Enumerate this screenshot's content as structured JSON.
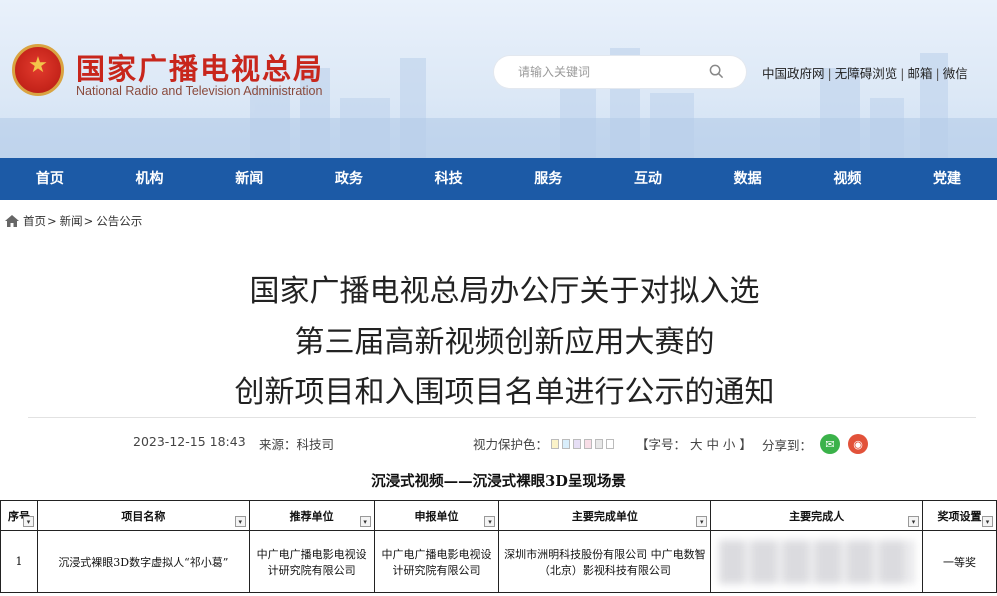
{
  "header": {
    "logo_cn": "国家广播电视总局",
    "logo_en": "National Radio and Television Administration",
    "search_placeholder": "请输入关键词",
    "top_links": [
      "中国政府网",
      "无障碍浏览",
      "邮箱",
      "微信"
    ]
  },
  "nav": [
    "首页",
    "机构",
    "新闻",
    "政务",
    "科技",
    "服务",
    "互动",
    "数据",
    "视频",
    "党建"
  ],
  "breadcrumb": [
    "首页",
    "新闻",
    "公告公示"
  ],
  "article": {
    "title_lines": [
      "国家广播电视总局办公厅关于对拟入选",
      "第三届高新视频创新应用大赛的",
      "创新项目和入围项目名单进行公示的通知"
    ],
    "date": "2023-12-15 18:43",
    "source": "来源：科技司",
    "vision_label": "视力保护色：",
    "vision_colors": [
      "#fbf3c9",
      "#d9eefb",
      "#e6def5",
      "#f8dde6",
      "#e8e8e8",
      "#ffffff"
    ],
    "font_size": "【字号： 大 中 小 】",
    "share_label": "分享到：",
    "share_icons": [
      "wechat-icon",
      "weibo-icon"
    ]
  },
  "table": {
    "caption": "沉浸式视频——沉浸式裸眼3D呈现场景",
    "headers": [
      "序号",
      "项目名称",
      "推荐单位",
      "申报单位",
      "主要完成单位",
      "主要完成人",
      "奖项设置"
    ],
    "rows": [
      {
        "index": "1",
        "name": "沉浸式裸眼3D数字虚拟人“祁小葛”",
        "recommender": "中广电广播电影电视设计研究院有限公司",
        "applicant": "中广电广播电影电视设计研究院有限公司",
        "units": "深圳市洲明科技股份有限公司 中广电数智（北京）影视科技有限公司",
        "award": "一等奖"
      }
    ]
  }
}
